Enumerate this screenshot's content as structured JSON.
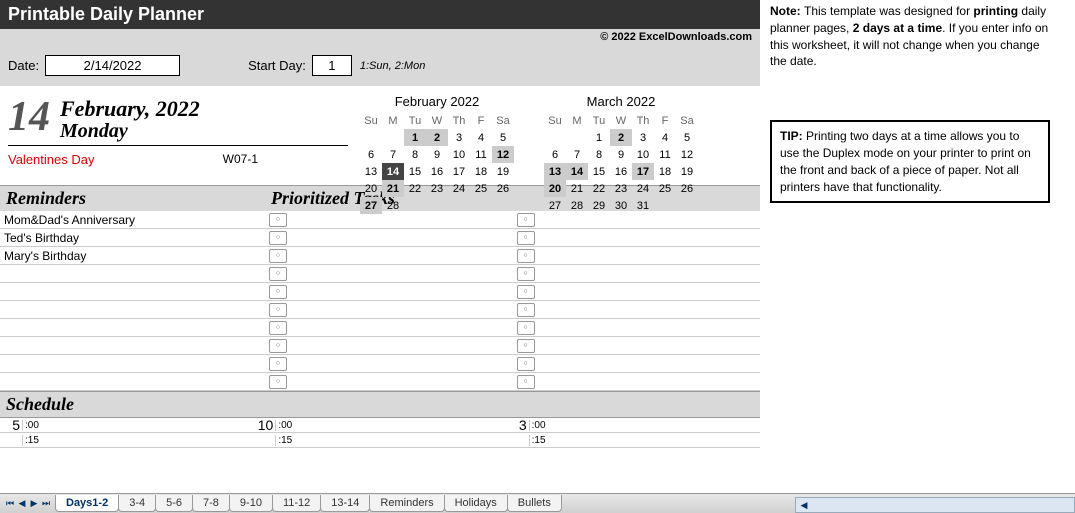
{
  "title": "Printable Daily Planner",
  "copyright": "© 2022 ExcelDownloads.com",
  "inputs": {
    "date_label": "Date:",
    "date_value": "2/14/2022",
    "startday_label": "Start Day:",
    "startday_value": "1",
    "startday_note": "1:Sun, 2:Mon"
  },
  "day": {
    "number": "14",
    "month_year": "February, 2022",
    "weekday": "Monday",
    "holiday": "Valentines Day",
    "week_num": "W07-1"
  },
  "cal1": {
    "title": "February 2022",
    "dow": [
      "Su",
      "M",
      "Tu",
      "W",
      "Th",
      "F",
      "Sa"
    ],
    "rows": [
      [
        "",
        "",
        "1",
        "2",
        "3",
        "4",
        "5"
      ],
      [
        "6",
        "7",
        "8",
        "9",
        "10",
        "11",
        "12"
      ],
      [
        "13",
        "14",
        "15",
        "16",
        "17",
        "18",
        "19"
      ],
      [
        "20",
        "21",
        "22",
        "23",
        "24",
        "25",
        "26"
      ],
      [
        "27",
        "28",
        "",
        "",
        "",
        "",
        ""
      ]
    ],
    "highlights": {
      "0-2": "hl",
      "0-3": "hl",
      "1-6": "hl",
      "2-1": "today",
      "3-1": "hl",
      "4-0": "hl"
    }
  },
  "cal2": {
    "title": "March 2022",
    "dow": [
      "Su",
      "M",
      "Tu",
      "W",
      "Th",
      "F",
      "Sa"
    ],
    "rows": [
      [
        "",
        "",
        "1",
        "2",
        "3",
        "4",
        "5"
      ],
      [
        "6",
        "7",
        "8",
        "9",
        "10",
        "11",
        "12"
      ],
      [
        "13",
        "14",
        "15",
        "16",
        "17",
        "18",
        "19"
      ],
      [
        "20",
        "21",
        "22",
        "23",
        "24",
        "25",
        "26"
      ],
      [
        "27",
        "28",
        "29",
        "30",
        "31",
        "",
        ""
      ]
    ],
    "highlights": {
      "0-3": "hl",
      "2-0": "hl",
      "2-1": "hl",
      "2-4": "hl",
      "3-0": "hl"
    }
  },
  "sections": {
    "reminders": "Reminders",
    "tasks": "Prioritized Tasks",
    "schedule": "Schedule"
  },
  "reminders": [
    "Mom&Dad's Anniversary",
    "Ted's Birthday",
    "Mary's Birthday",
    "",
    "",
    "",
    "",
    "",
    "",
    ""
  ],
  "task_rows": 10,
  "schedule": {
    "cols": [
      {
        "hour": "5",
        "mins": [
          ":00",
          ":15"
        ]
      },
      {
        "hour": "10",
        "mins": [
          ":00",
          ":15"
        ]
      },
      {
        "hour": "3",
        "mins": [
          ":00",
          ":15"
        ]
      }
    ]
  },
  "note": {
    "prefix": "Note: ",
    "b1": "printing",
    "t1": "This template was designed for ",
    "t2": " daily planner pages, ",
    "b2": "2 days at a time",
    "t3": ". If you enter info on this worksheet, it will not change when you change the date."
  },
  "tip": {
    "prefix": "TIP: ",
    "text": "Printing two days at a time allows you to use the Duplex mode on your printer to print on the front and back of a piece of paper. Not all printers have that functionality."
  },
  "tabs": [
    "Days1-2",
    "3-4",
    "5-6",
    "7-8",
    "9-10",
    "11-12",
    "13-14",
    "Reminders",
    "Holidays",
    "Bullets"
  ],
  "active_tab": 0
}
